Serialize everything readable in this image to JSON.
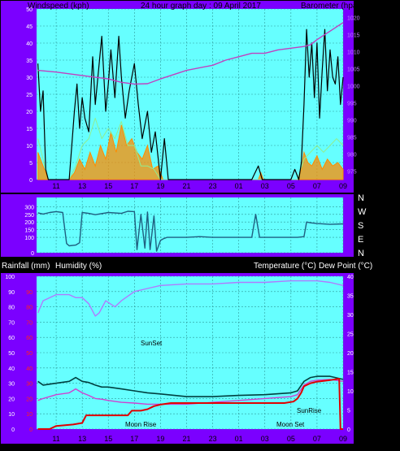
{
  "top_labels": {
    "windspeed": "Windspeed (kph)",
    "title": "24 hour graph day : 09 April 2017",
    "barometer": "Barometer (hpa)"
  },
  "bottom_labels": {
    "rainfall": "Rainfall (mm)",
    "humidity": "Humidity (%)",
    "temperature": "Temperature (°C)",
    "dew_point": "Dew Point (°C)"
  },
  "annotations": {
    "sunset": "SunSet",
    "moonrise": "Moon Rise",
    "sunrise": "SunRise",
    "moonset": "Moon Set"
  },
  "colors": {
    "panel_bg": "#66FFFF",
    "frame": "#7B00FF",
    "grid": "#2E9A9A",
    "gust": "#000000",
    "wind_avg": "#FF8C00",
    "wind_green": "#90EE90",
    "barometer": "#C040C0",
    "direction": "#1F5F80",
    "humidity": "#B07AFF",
    "temperature": "#004040",
    "dew_point": "#D040D0",
    "rain": "#E00000",
    "left_axis_text": "#FFFFFF",
    "rain_axis_text": "#FF2020"
  },
  "x_ticks": [
    "11",
    "13",
    "15",
    "17",
    "19",
    "21",
    "23",
    "01",
    "03",
    "05",
    "07",
    "09"
  ],
  "chart_data": [
    {
      "type": "line",
      "title": "24 hour graph day : 09 April 2017",
      "xlabel": "",
      "ylabel": "Windspeed (kph)",
      "y2label": "Barometer (hpa)",
      "x_range_hours": [
        9.5,
        33.0
      ],
      "ylim": [
        0,
        50
      ],
      "y_ticks": [
        0,
        5,
        10,
        15,
        20,
        25,
        30,
        35,
        40,
        45,
        50
      ],
      "y2lim": [
        972.5,
        1022.5
      ],
      "y2_ticks": [
        975,
        980,
        985,
        990,
        995,
        1000,
        1005,
        1010,
        1015,
        1020
      ],
      "grid": true,
      "series": [
        {
          "name": "Windspeed (kph)",
          "color": "#000000",
          "x": [
            9.6,
            9.8,
            10.0,
            10.2,
            10.4,
            11.0,
            11.5,
            12.0,
            12.2,
            12.4,
            12.6,
            12.8,
            13.0,
            13.2,
            13.5,
            13.8,
            14.0,
            14.2,
            14.5,
            14.8,
            15.0,
            15.2,
            15.5,
            15.8,
            16.0,
            16.3,
            16.6,
            17.0,
            17.3,
            17.6,
            18.0,
            18.3,
            18.6,
            19.0,
            19.3,
            19.6,
            20.0,
            22.0,
            24.0,
            26.0,
            26.5,
            26.8,
            27.0,
            28.0,
            29.0,
            29.3,
            29.6,
            29.8,
            30.0,
            30.2,
            30.4,
            30.6,
            30.8,
            31.0,
            31.2,
            31.4,
            31.6,
            31.8,
            32.0,
            32.2,
            32.4,
            32.6,
            32.8,
            33.0
          ],
          "values": [
            34,
            20,
            26,
            3,
            0,
            0,
            0,
            0,
            10,
            20,
            28,
            15,
            24,
            18,
            14,
            36,
            22,
            30,
            42,
            20,
            28,
            38,
            24,
            42,
            30,
            18,
            26,
            34,
            22,
            12,
            20,
            8,
            14,
            0,
            12,
            0,
            0,
            0,
            0,
            0,
            4,
            0,
            0,
            0,
            0,
            3,
            0,
            5,
            22,
            44,
            30,
            40,
            24,
            40,
            18,
            32,
            44,
            26,
            38,
            30,
            28,
            36,
            22,
            30
          ]
        },
        {
          "name": "Wind Average",
          "color": "#FF8C00",
          "x": [
            9.6,
            10.0,
            10.4,
            12.0,
            12.4,
            12.8,
            13.2,
            13.6,
            14.0,
            14.4,
            14.8,
            15.2,
            15.6,
            16.0,
            16.4,
            16.8,
            17.2,
            17.6,
            18.0,
            18.4,
            18.8,
            19.2,
            20.0,
            26.5,
            26.7,
            26.9,
            29.5,
            29.8,
            30.0,
            30.3,
            30.6,
            31.0,
            31.4,
            31.8,
            32.2,
            32.6,
            33.0
          ],
          "values": [
            8,
            4,
            0,
            0,
            2,
            6,
            3,
            8,
            4,
            10,
            6,
            14,
            8,
            16,
            10,
            12,
            8,
            6,
            10,
            3,
            4,
            0,
            0,
            0,
            2,
            0,
            0,
            3,
            8,
            5,
            4,
            7,
            3,
            6,
            4,
            5,
            3
          ]
        },
        {
          "name": "Wind (green)",
          "color": "#90EE90",
          "x": [
            9.6,
            10.0,
            10.4,
            12.0,
            12.5,
            13.0,
            13.5,
            14.0,
            14.5,
            15.0,
            15.5,
            16.0,
            16.5,
            17.0,
            17.5,
            18.0,
            18.5,
            19.0,
            20.0,
            29.5,
            30.0,
            30.5,
            31.0,
            31.5,
            32.0,
            32.5,
            33.0
          ],
          "values": [
            12,
            6,
            0,
            0,
            4,
            10,
            12,
            18,
            12,
            15,
            12,
            17,
            10,
            10,
            4,
            4,
            3,
            0,
            0,
            0,
            6,
            8,
            10,
            8,
            10,
            12,
            10
          ]
        },
        {
          "name": "Barometer (hpa)",
          "color": "#C040C0",
          "axis": "right",
          "x": [
            9.6,
            11.0,
            13.0,
            15.0,
            16.0,
            17.0,
            18.0,
            19.0,
            21.0,
            23.0,
            24.0,
            25.0,
            26.0,
            27.0,
            28.0,
            29.0,
            30.0,
            30.5,
            31.0,
            32.0,
            33.0
          ],
          "values": [
            1004.5,
            1004.0,
            1003.0,
            1002.0,
            1001.0,
            1000.5,
            1000.6,
            1002.0,
            1004.5,
            1006.0,
            1007.5,
            1008.5,
            1009.5,
            1009.5,
            1010.5,
            1011.0,
            1011.5,
            1012.0,
            1013.5,
            1016.0,
            1018.5
          ]
        }
      ]
    },
    {
      "type": "line",
      "title": "",
      "ylabel": "Wind Direction",
      "ylim": [
        0,
        360
      ],
      "y_ticks": [
        0,
        100,
        150,
        200,
        250,
        300
      ],
      "y_tick_labels": [
        "0",
        "100",
        "150",
        "200",
        "250",
        "300"
      ],
      "right_labels": [
        "N",
        "W",
        "S",
        "E",
        "N"
      ],
      "grid": true,
      "series": [
        {
          "name": "Wind Direction",
          "color": "#1F5F80",
          "x": [
            9.6,
            10.0,
            10.5,
            11.0,
            11.5,
            11.8,
            12.0,
            12.5,
            12.8,
            13.0,
            13.5,
            14.0,
            15.0,
            16.0,
            16.5,
            17.0,
            17.2,
            17.5,
            17.8,
            18.0,
            18.2,
            18.5,
            18.7,
            19.0,
            19.2,
            19.5,
            20.0,
            21.0,
            22.0,
            23.0,
            24.0,
            25.0,
            26.0,
            26.3,
            26.6,
            27.0,
            28.0,
            29.0,
            29.5,
            30.0,
            30.2,
            30.5,
            31.0,
            32.0,
            33.0
          ],
          "values": [
            260,
            252,
            262,
            268,
            262,
            60,
            45,
            50,
            65,
            262,
            256,
            248,
            262,
            256,
            270,
            268,
            20,
            250,
            30,
            265,
            20,
            240,
            10,
            80,
            90,
            100,
            100,
            100,
            105,
            100,
            100,
            100,
            100,
            250,
            100,
            100,
            100,
            100,
            100,
            105,
            200,
            195,
            190,
            185,
            188
          ]
        }
      ]
    },
    {
      "type": "line",
      "title": "",
      "ylabel": "Rainfall (mm) / Humidity (%)",
      "y2label": "Temperature (°C) / Dew Point (°C)",
      "ylim": [
        0,
        100
      ],
      "y_ticks": [
        0,
        10,
        20,
        30,
        40,
        50,
        60,
        70,
        80,
        90,
        100
      ],
      "rain_ticks": [
        0,
        10,
        20,
        30,
        40,
        50,
        60,
        70,
        80,
        90
      ],
      "rain_tick_labels": [
        "0",
        "10",
        "20",
        "30",
        "40",
        "50",
        "60",
        "70",
        "80",
        "90"
      ],
      "y2lim": [
        0,
        40
      ],
      "y2_ticks": [
        0,
        5,
        10,
        15,
        20,
        25,
        30,
        35,
        40
      ],
      "grid": true,
      "series": [
        {
          "name": "Humidity (%)",
          "color": "#B07AFF",
          "axis": "left",
          "x": [
            9.6,
            10.0,
            11.0,
            12.0,
            12.5,
            13.0,
            13.5,
            14.0,
            14.3,
            14.8,
            15.5,
            16.0,
            17.0,
            18.0,
            19.0,
            21.0,
            23.0,
            25.0,
            27.0,
            29.0,
            31.0,
            32.0,
            33.0
          ],
          "values": [
            76,
            84,
            88,
            88,
            86,
            86,
            82,
            74,
            76,
            84,
            80,
            84,
            90,
            92,
            94,
            95,
            95,
            96,
            96,
            97,
            97,
            96,
            94
          ]
        },
        {
          "name": "Temperature (°C)",
          "color": "#004040",
          "axis": "right",
          "x": [
            9.6,
            10.0,
            11.0,
            12.0,
            12.5,
            13.0,
            13.5,
            14.0,
            14.5,
            15.0,
            16.0,
            17.0,
            18.0,
            19.0,
            21.0,
            23.0,
            25.0,
            27.0,
            29.0,
            29.5,
            30.0,
            30.5,
            31.0,
            32.0,
            33.0
          ],
          "values": [
            12.5,
            11.5,
            12.0,
            12.5,
            13.5,
            12.5,
            12.2,
            11.5,
            11.0,
            11.0,
            10.5,
            10.0,
            9.5,
            9.2,
            8.5,
            8.5,
            8.8,
            9.0,
            9.5,
            10.0,
            12.5,
            13.5,
            13.8,
            13.8,
            13.0
          ]
        },
        {
          "name": "Dew Point (°C)",
          "color": "#D040D0",
          "axis": "right",
          "x": [
            9.6,
            10.0,
            11.0,
            12.0,
            12.5,
            13.0,
            13.5,
            14.0,
            14.5,
            15.0,
            16.0,
            17.0,
            18.0,
            19.0,
            21.0,
            23.0,
            25.0,
            27.0,
            29.0,
            29.5,
            30.0,
            30.5,
            31.0,
            32.0,
            33.0
          ],
          "values": [
            7.5,
            8.0,
            9.0,
            9.5,
            10.5,
            9.5,
            8.8,
            8.0,
            7.8,
            7.5,
            7.0,
            6.8,
            6.5,
            6.5,
            6.5,
            7.0,
            7.5,
            8.0,
            8.5,
            9.0,
            11.5,
            12.5,
            12.8,
            13.0,
            12.5
          ]
        },
        {
          "name": "Rainfall (mm)",
          "color": "#E00000",
          "axis": "left",
          "x": [
            9.6,
            10.5,
            11.0,
            12.3,
            13.0,
            13.3,
            14.0,
            16.0,
            16.5,
            16.8,
            17.5,
            18.0,
            18.5,
            19.0,
            19.8,
            21.0,
            23.0,
            25.0,
            27.0,
            28.5,
            29.2,
            29.5,
            29.8,
            30.0,
            30.5,
            31.0,
            32.0,
            32.7,
            32.8,
            33.0
          ],
          "values": [
            0,
            0,
            2,
            3,
            4,
            9,
            9,
            9,
            9,
            12,
            12,
            13,
            15,
            16,
            17,
            17,
            17,
            17,
            17,
            17,
            18,
            20,
            24,
            28,
            30,
            31,
            32,
            33,
            0,
            0
          ]
        }
      ]
    }
  ]
}
